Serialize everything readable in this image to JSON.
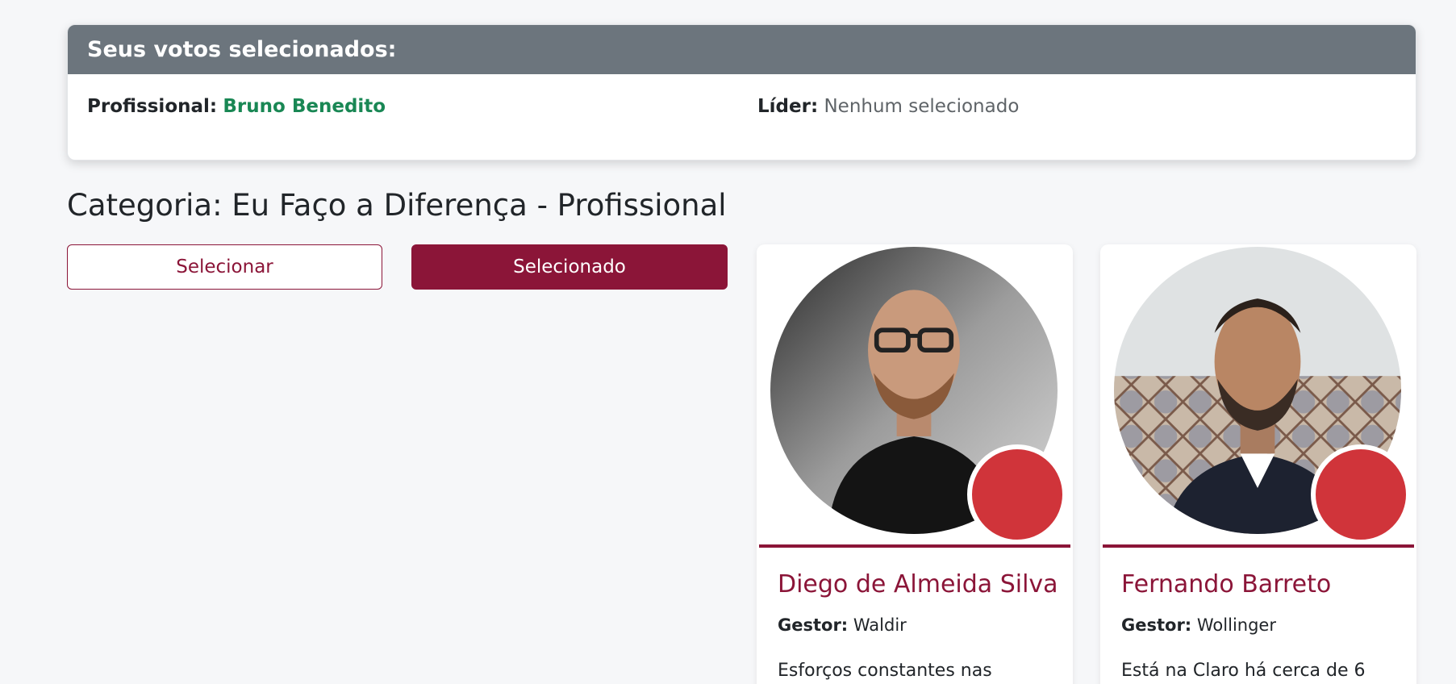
{
  "votes": {
    "header": "Seus votos selecionados:",
    "profissional_label": "Profissional:",
    "profissional_value": "Bruno Benedito",
    "lider_label": "Líder:",
    "lider_value": "Nenhum selecionado"
  },
  "category": {
    "title": "Categoria: Eu Faço a Diferença - Profissional"
  },
  "buttons": {
    "select_label": "Selecionar",
    "selected_label": "Selecionado"
  },
  "candidates": [
    {
      "name": "Diego de Almeida Silva",
      "gestor_label": "Gestor:",
      "gestor": "Waldir",
      "description": "Esforços constantes nas"
    },
    {
      "name": "Fernando Barreto",
      "gestor_label": "Gestor:",
      "gestor": "Wollinger",
      "description": "Está na Claro há cerca de 6"
    }
  ],
  "colors": {
    "brand": "#8b1538",
    "header_gray": "#6c757d",
    "success": "#198754",
    "badge_red": "#d0343a"
  }
}
